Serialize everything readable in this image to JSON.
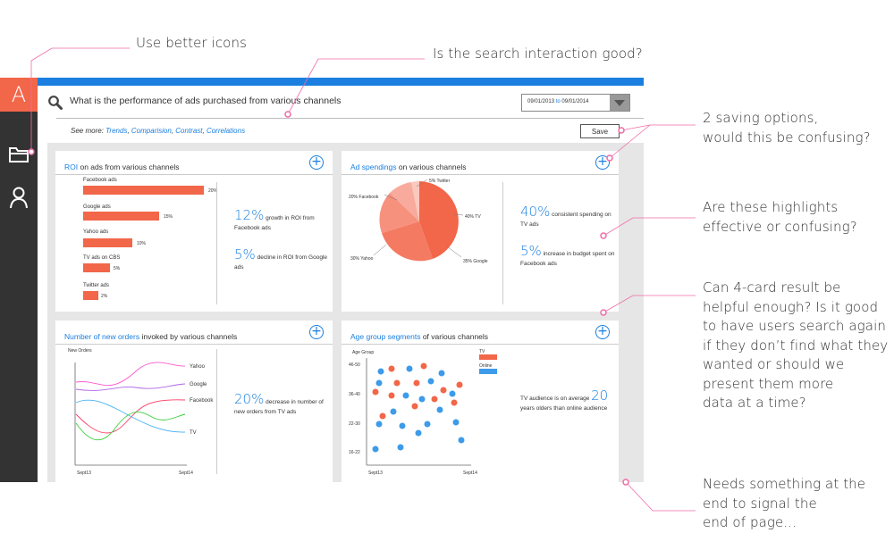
{
  "app": {
    "logo_letter": "A",
    "accent": "#f26649",
    "brand_blue": "#1a7fe0",
    "sidebar_icons": [
      "folder-icon",
      "user-icon"
    ]
  },
  "search": {
    "query": "What is the performance of ads purchased from various channels",
    "date_from": "09/01/2013",
    "date_to_word": "to",
    "date_to": "09/01/2014"
  },
  "see_more": {
    "prefix": "See more:",
    "links": [
      "Trends",
      "Comparision",
      "Contrast",
      "Correlations"
    ]
  },
  "save_label": "Save",
  "cards": {
    "roi": {
      "title_hl": "ROI",
      "title_rest": " on ads from various channels",
      "bars": [
        {
          "label": "Facebook ads",
          "value": "20%"
        },
        {
          "label": "Google ads",
          "value": "15%"
        },
        {
          "label": "Yahoo ads",
          "value": "10%"
        },
        {
          "label": "TV ads on CBS",
          "value": "5%"
        },
        {
          "label": "Twitter ads",
          "value": "2%"
        }
      ],
      "stat1_big": "12%",
      "stat1_small": " growth in ROI from Facebook ads",
      "stat2_big": "5%",
      "stat2_small": " decline in ROI from Google ads"
    },
    "spend": {
      "title_hl": "Ad spendings",
      "title_rest": " on various channels",
      "slices": [
        {
          "label": "40% TV",
          "value": 40
        },
        {
          "label": "35% Google",
          "value": 35
        },
        {
          "label": "30% Yahoo",
          "value": 30
        },
        {
          "label": "20% Facebook",
          "value": 20
        },
        {
          "label": "5% Twitter",
          "value": 5
        }
      ],
      "stat1_big": "40%",
      "stat1_small": " consistent spending on TV ads",
      "stat2_big": "5%",
      "stat2_small": " increase in budget spent on Facebook ads"
    },
    "orders": {
      "title_hl": "Number of new orders",
      "title_rest": " invoked by various channels",
      "ylabel": "New Orders",
      "x_start": "Sept13",
      "x_end": "Sept14",
      "series_labels": [
        "Yahoo",
        "Google",
        "Facebook",
        "TV"
      ],
      "stat_big": "20%",
      "stat_small": " decrease in number of new orders from TV ads"
    },
    "age": {
      "title_hl": "Age group segments",
      "title_rest": " of various channels",
      "ylabel": "Age Group",
      "yticks": [
        "46-50",
        "36-40",
        "22-30",
        "16-22"
      ],
      "x_start": "Sept13",
      "x_end": "Sept14",
      "legend": [
        {
          "label": "TV",
          "color": "#f26649"
        },
        {
          "label": "Online",
          "color": "#3d9be9"
        }
      ],
      "stat_prefix": "TV audience is on average ",
      "stat_big": "20",
      "stat_suffix": " years olders than online audience"
    }
  },
  "annotations": {
    "icons": "Use better icons",
    "search": "Is the search interaction good?",
    "saving": [
      "2 saving options,",
      "would this be confusing?"
    ],
    "highlights": [
      "Are these highlights",
      "effective or confusing?"
    ],
    "cards": [
      "Can 4-card result be",
      "helpful enough? Is it good",
      "to have users search again",
      "if they don’t find what they",
      "wanted or should we",
      "present them more",
      "data at a time?"
    ],
    "end": [
      "Needs something at the",
      "end to signal the",
      "end of page..."
    ]
  }
}
